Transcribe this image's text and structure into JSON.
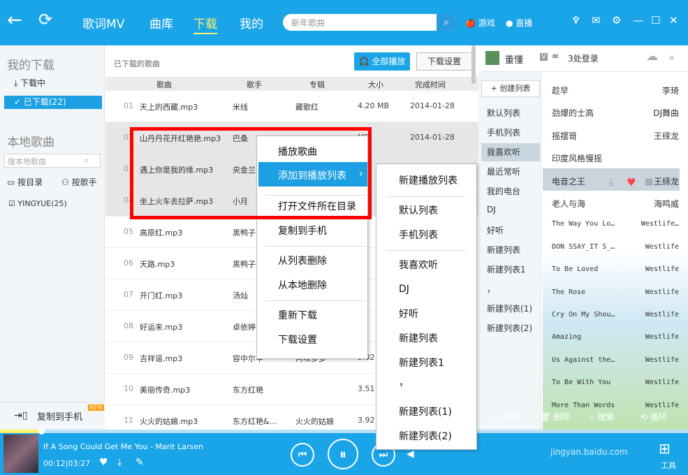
{
  "top": {
    "nav": [
      "歌词MV",
      "曲库",
      "下载",
      "我的"
    ],
    "search_placeholder": "新年歌曲",
    "links": [
      "游戏",
      "直播"
    ]
  },
  "left": {
    "my_download": "我的下载",
    "downloading": "下载中",
    "downloaded": "已下载(22)",
    "local": "本地歌曲",
    "search_placeholder": "搜本地歌曲",
    "by_dir": "按目录",
    "by_singer": "按歌手",
    "folder": "YINGYUE(25)",
    "copy_phone": "复制到手机",
    "new_badge": "NEW"
  },
  "main": {
    "title": "已下载的歌曲",
    "play_all": "全部播放",
    "settings": "下载设置",
    "headers": [
      "歌曲",
      "歌手",
      "专辑",
      "大小",
      "完成时间"
    ],
    "rows": [
      {
        "n": "01",
        "t": "天上的西藏.mp3",
        "a": "米线",
        "b": "藏歌红",
        "s": "4.20 MB",
        "d": "2014-01-28"
      },
      {
        "n": "02",
        "t": "山丹丹花开红艳艳.mp3",
        "a": "巴桑",
        "b": "",
        "s": "MB",
        "d": "2014-01-28"
      },
      {
        "n": "03",
        "t": "遇上你是我的缘.mp3",
        "a": "央金兰",
        "b": "",
        "s": "",
        "d": ""
      },
      {
        "n": "04",
        "t": "坐上火车去拉萨.mp3",
        "a": "小月",
        "b": "",
        "s": "",
        "d": ""
      },
      {
        "n": "05",
        "t": "高原红.mp3",
        "a": "黑鸭子",
        "b": "",
        "s": "",
        "d": ""
      },
      {
        "n": "06",
        "t": "天路.mp3",
        "a": "黑鸭子",
        "b": "",
        "s": "",
        "d": ""
      },
      {
        "n": "07",
        "t": "开门红.mp3",
        "a": "汤灿",
        "b": "",
        "s": "",
        "d": ""
      },
      {
        "n": "08",
        "t": "好运来.mp3",
        "a": "卓依婷",
        "b": "",
        "s": "",
        "d": ""
      },
      {
        "n": "09",
        "t": "吉祥谣.mp3",
        "a": "容中尔甲",
        "b": "阿咪多多",
        "s": "3.02",
        "d": ""
      },
      {
        "n": "10",
        "t": "美丽传奇.mp3",
        "a": "东方红艳",
        "b": "",
        "s": "3.51",
        "d": ""
      },
      {
        "n": "11",
        "t": "火火的姑娘.mp3",
        "a": "东方红艳&…",
        "b": "火火的姑娘",
        "s": "3.92",
        "d": ""
      }
    ]
  },
  "context_menu": {
    "items": [
      "播放歌曲",
      "添加到播放列表",
      "打开文件所在目录",
      "复制到手机",
      "从列表删除",
      "从本地删除",
      "重新下载",
      "下载设置"
    ],
    "arrow": "›"
  },
  "submenu": {
    "items": [
      "新建播放列表",
      "默认列表",
      "手机列表",
      "我喜欢听",
      "DJ",
      "好听",
      "新建列表",
      "新建列表1",
      "，",
      "新建列表(1)",
      "新建列表(2)"
    ]
  },
  "right": {
    "user": "董懂",
    "vip": "V",
    "login": "3处登录",
    "create": "+ 创建列表",
    "lists": [
      "默认列表",
      "手机列表",
      "我喜欢听",
      "最近常听",
      "我的电台",
      "DJ",
      "好听",
      "新建列表",
      "新建列表1",
      "，",
      "新建列表(1)",
      "新建列表(2)"
    ],
    "songs": [
      {
        "x": "趁早",
        "y": "李琦"
      },
      {
        "x": "劲爆的士高",
        "y": "DJ舞曲"
      },
      {
        "x": "摇摆哥",
        "y": "王绎龙"
      },
      {
        "x": "印度风格慢摇",
        "y": ""
      },
      {
        "x": "电音之王",
        "y": "王绎龙"
      },
      {
        "x": "老人与海",
        "y": "海鸣威"
      },
      {
        "x": "The Way You Lo…",
        "y": "Westlife…"
      },
      {
        "x": "DON SSAY_IT S_…",
        "y": "Westlife"
      },
      {
        "x": "To Be Loved",
        "y": "Westlife"
      },
      {
        "x": "The Rose",
        "y": "Westlife"
      },
      {
        "x": "Cry On My Shou…",
        "y": "Westlife"
      },
      {
        "x": "Amazing",
        "y": "Westlife"
      },
      {
        "x": "Us Against the…",
        "y": "Westlife"
      },
      {
        "x": "To Be With You",
        "y": "Westlife"
      },
      {
        "x": "More Than Words",
        "y": "Westlife"
      }
    ],
    "add": "添加",
    "delete": "删除",
    "search": "搜索",
    "loop": "循环"
  },
  "player": {
    "song": "If A Song Could Get Me You - Marit Larsen",
    "time": "00:12|03:27",
    "tools": "工具",
    "progress": 0.06
  },
  "watermark": "jingyan.baidu.com"
}
